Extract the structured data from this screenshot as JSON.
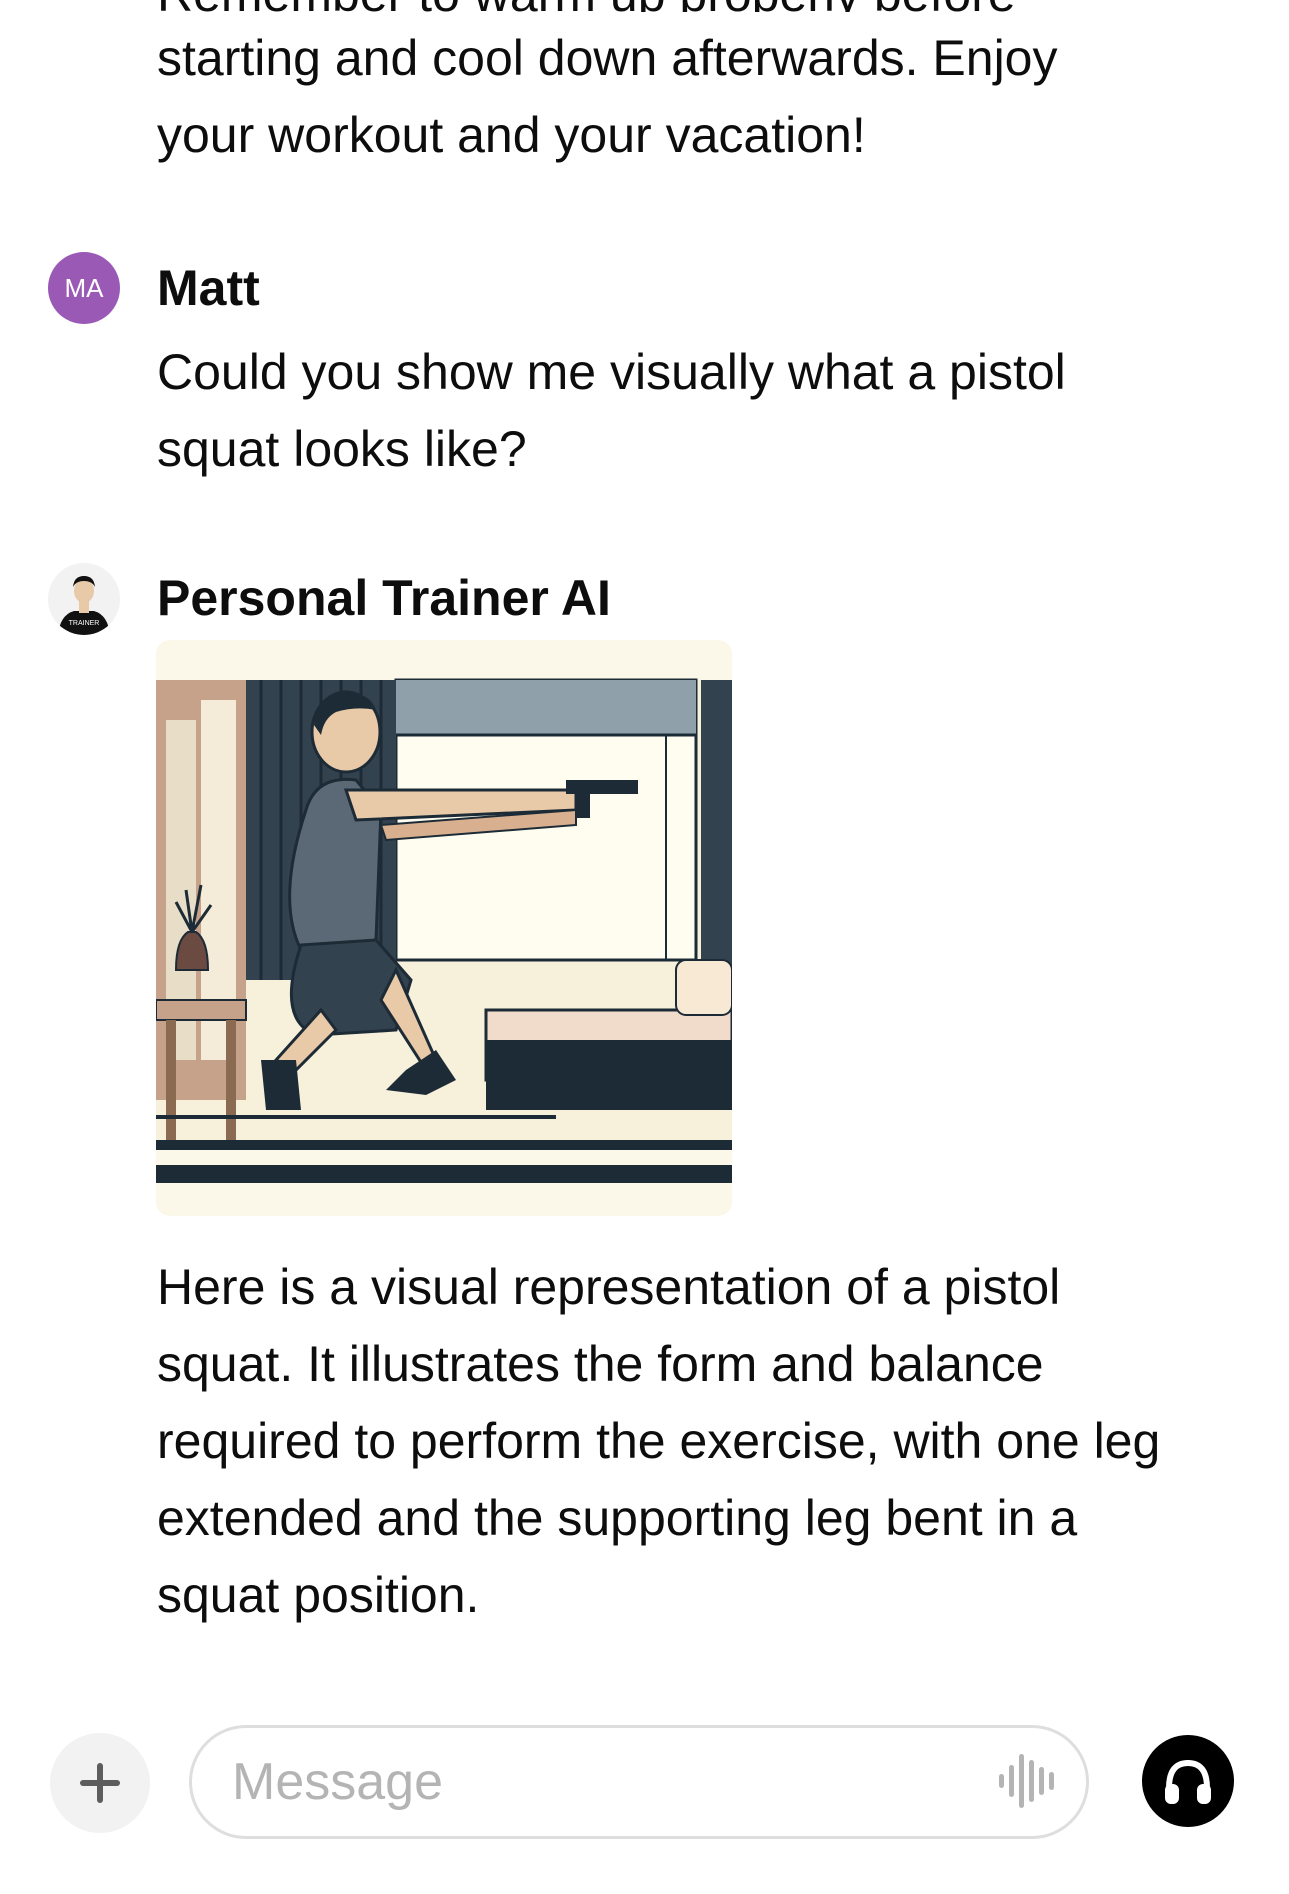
{
  "conversation": {
    "previous_message_tail": {
      "line_partial": "Remember to warm up properly before",
      "text": "starting and cool down afterwards. Enjoy your workout and your vacation!"
    },
    "user_message": {
      "avatar_initials": "MA",
      "avatar_color": "#9b59b6",
      "author": "Matt",
      "text": "Could you show me visually what a pistol squat looks like?"
    },
    "assistant_message": {
      "author": "Personal Trainer AI",
      "avatar_icon": "trainer-avatar-icon",
      "avatar_shirt_text": "TRAINER",
      "image_icon": "pistol-squat-illustration",
      "text": "Here is a visual representation of a pistol squat. It illustrates the form and balance required to perform the exercise, with one leg extended and the supporting leg bent in a squat position."
    }
  },
  "composer": {
    "placeholder": "Message",
    "attach_icon": "plus-icon",
    "voice_icon": "waveform-icon",
    "voice_mode_icon": "headphones-icon"
  }
}
